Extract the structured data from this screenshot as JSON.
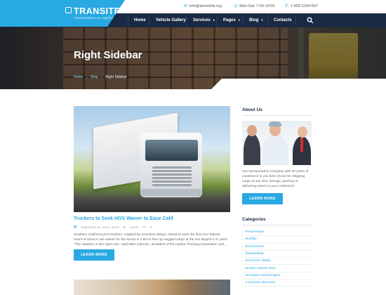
{
  "brand": {
    "name": "TRANSITEC",
    "tagline": "Transportation & Logistics"
  },
  "topbar": {
    "email": "info@demolink.org",
    "hours": "Mon-Sat: 7:00-19:00",
    "phone": "1-800-1234-567"
  },
  "nav": {
    "items": [
      {
        "label": "Home"
      },
      {
        "label": "Vehicle Gallery"
      },
      {
        "label": "Services",
        "has_dropdown": true
      },
      {
        "label": "Pages",
        "has_dropdown": true
      },
      {
        "label": "Blog",
        "has_dropdown": true
      },
      {
        "label": "Contacts"
      }
    ],
    "search_icon": "search-icon"
  },
  "hero": {
    "title": "Right Sidebar",
    "breadcrumb": [
      "Home",
      "Blog",
      "Right Sidebar"
    ],
    "breadcrumb_sep": "→"
  },
  "post": {
    "title": "Truckers to Seek HOS Waiver to Ease Calif",
    "date": "September 15, 2015, 09:23",
    "author": "Admin",
    "comments": "0",
    "excerpt": "Southern California port truckers, crippled by extensive delays, intend to seek the first-ever federal hours-of-service rule waiver for the sector in a bid to free up clogged cargo at the two largest U.S. ports. \"The situation is dire right now,\" said Mike Johnson, president of the Harbor Trucking Association and…",
    "button": "LEARN MORE"
  },
  "sidebar": {
    "about": {
      "heading": "About Us",
      "text": "Our transportation company with 30 years of experience is you best choice for shipping cargo of any size, storage, packing or delivering wares to your customers.",
      "button": "LEARN MORE"
    },
    "categories": {
      "heading": "Categories",
      "items": [
        "Preservation",
        "Mobility",
        "Environment",
        "Stewardship",
        "Economic Vitality",
        "Modern vehicle fleet",
        "Innovative technologies",
        "Corporate discounts"
      ]
    }
  },
  "colors": {
    "accent": "#29a9e1",
    "nav_bg": "#1a2a44"
  }
}
